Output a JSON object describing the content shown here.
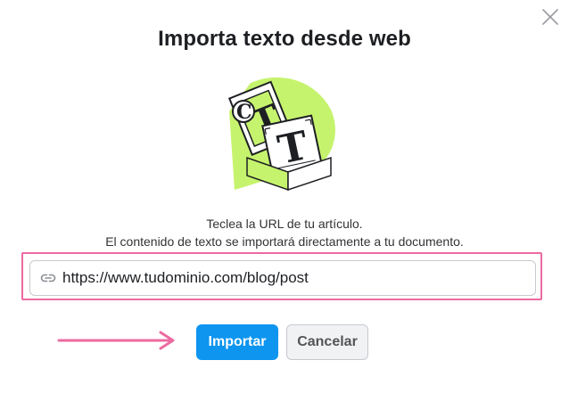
{
  "dialog": {
    "title": "Importa texto desde web",
    "close_icon": "close-icon",
    "illustration_icon": "text-import-illustration",
    "description_line1": "Teclea la URL de tu artículo.",
    "description_line2": "El contenido de texto se importará directamente a tu documento.",
    "url_field": {
      "icon": "link-icon",
      "value": "https://www.tudominio.com/blog/post"
    },
    "buttons": {
      "import_label": "Importar",
      "cancel_label": "Cancelar"
    }
  },
  "colors": {
    "primary": "#0d95f0",
    "highlight": "#ec6aa0",
    "illustration_accent": "#c6f36d",
    "title": "#1d1f23"
  }
}
